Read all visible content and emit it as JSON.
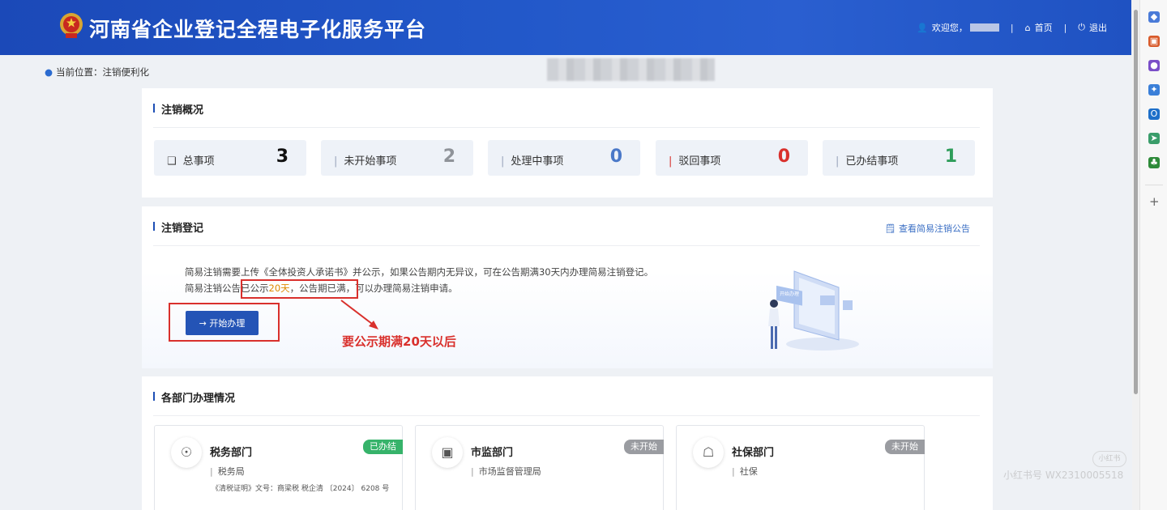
{
  "header": {
    "title": "河南省企业登记全程电子化服务平台",
    "welcome": "欢迎您，",
    "home": "首页",
    "logout": "退出"
  },
  "breadcrumb": "当前位置：注销便利化",
  "overview": {
    "title": "注销概况",
    "stats": [
      {
        "label": "总事项",
        "value": "3",
        "color": "#111111"
      },
      {
        "label": "未开始事项",
        "value": "2",
        "color": "#8f9399"
      },
      {
        "label": "处理中事项",
        "value": "0",
        "color": "#4a78c8"
      },
      {
        "label": "驳回事项",
        "value": "0",
        "color": "#d9302c"
      },
      {
        "label": "已办结事项",
        "value": "1",
        "color": "#2e9d5a"
      }
    ]
  },
  "register": {
    "title": "注销登记",
    "notice_link": "查看简易注销公告",
    "line1": "简易注销需要上传《全体投资人承诺书》并公示，如果公告期内无异议，可在公告期满30天内办理简易注销登记。",
    "line2_a": "简易注销公告",
    "line2_b": "已公示",
    "line2_days": "20天",
    "line2_c": "，公告期已满",
    "line2_d": "，可以办理简易注销申请。",
    "start_button": "开始办理",
    "annotation": "要公示期满20天以后",
    "illustration_text": "开始办理"
  },
  "departments": {
    "title": "各部门办理情况",
    "items": [
      {
        "name": "税务部门",
        "sub": "税务局",
        "status": "已办结",
        "status_color": "#36b36a",
        "doc": "《清税证明》文号：商梁税 税企清 〔2024〕 6208 号"
      },
      {
        "name": "市监部门",
        "sub": "市场监督管理局",
        "status": "未开始",
        "status_color": "#9a9ca1",
        "doc": ""
      },
      {
        "name": "社保部门",
        "sub": "社保",
        "status": "未开始",
        "status_color": "#9a9ca1",
        "doc": ""
      }
    ]
  },
  "watermark": {
    "badge": "小红书",
    "text": "小红书号 WX2310005518"
  }
}
